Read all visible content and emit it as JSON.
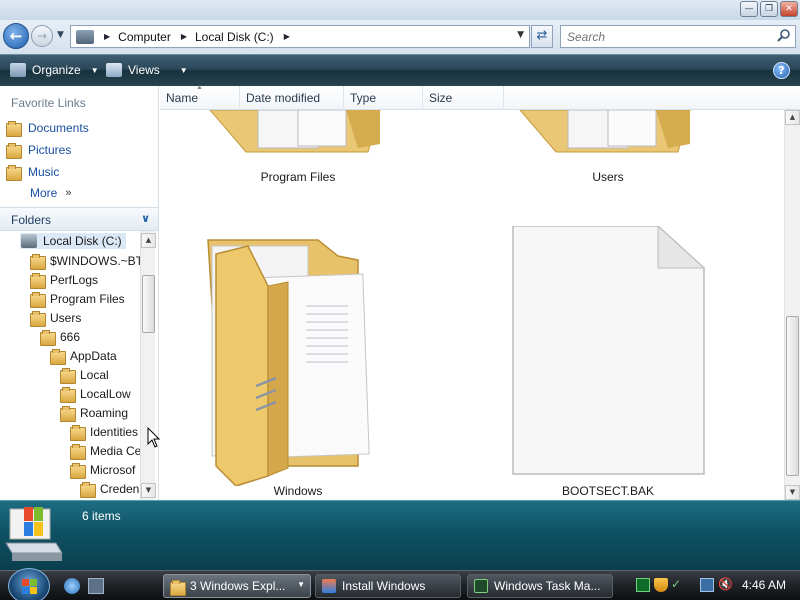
{
  "address": {
    "crumbs": [
      "Computer",
      "Local Disk (C:)"
    ],
    "search_placeholder": "Search"
  },
  "commandbar": {
    "organize_label": "Organize",
    "views_label": "Views",
    "help_label": "?"
  },
  "favorites": {
    "title": "Favorite Links",
    "items": [
      {
        "label": "Documents",
        "icon": "documents-icon"
      },
      {
        "label": "Pictures",
        "icon": "pictures-icon"
      },
      {
        "label": "Music",
        "icon": "music-icon"
      },
      {
        "label": "More",
        "icon": "double-chevron-icon"
      }
    ]
  },
  "folders": {
    "title": "Folders",
    "tree": [
      {
        "label": "Local Disk (C:)",
        "depth": 0,
        "type": "drive",
        "selected": true
      },
      {
        "label": "$WINDOWS.~BT",
        "depth": 1
      },
      {
        "label": "PerfLogs",
        "depth": 1
      },
      {
        "label": "Program Files",
        "depth": 1
      },
      {
        "label": "Users",
        "depth": 1
      },
      {
        "label": "666",
        "depth": 2
      },
      {
        "label": "AppData",
        "depth": 3
      },
      {
        "label": "Local",
        "depth": 4
      },
      {
        "label": "LocalLow",
        "depth": 4
      },
      {
        "label": "Roaming",
        "depth": 4
      },
      {
        "label": "Identities",
        "depth": 5
      },
      {
        "label": "Media Ce",
        "depth": 5
      },
      {
        "label": "Microsof",
        "depth": 5
      },
      {
        "label": "Creden",
        "depth": 6
      }
    ]
  },
  "columns": [
    "Name",
    "Date modified",
    "Type",
    "Size"
  ],
  "files": [
    {
      "label": "Program Files",
      "type": "folder"
    },
    {
      "label": "Users",
      "type": "folder"
    },
    {
      "label": "Windows",
      "type": "folder"
    },
    {
      "label": "BOOTSECT.BAK",
      "type": "file"
    }
  ],
  "details": {
    "count_text": "6 items"
  },
  "taskbar": {
    "tasks": [
      {
        "label": "3 Windows Expl...",
        "active": true
      },
      {
        "label": "Install Windows",
        "active": false
      },
      {
        "label": "Windows Task Ma...",
        "active": false
      }
    ],
    "clock": "4:46 AM"
  },
  "colors": {
    "accent_blue": "#1a4fa0",
    "details_teal": "#0f5264",
    "folder_yellow": "#f0c86a"
  }
}
